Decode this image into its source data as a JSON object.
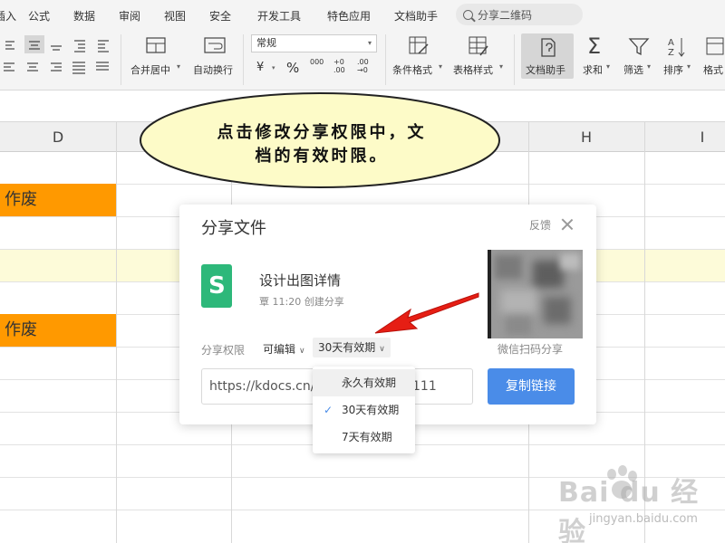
{
  "menu": {
    "items": [
      "插入",
      "公式",
      "数据",
      "审阅",
      "视图",
      "安全",
      "开发工具",
      "特色应用",
      "文档助手"
    ],
    "search_label": "分享二维码"
  },
  "ribbon": {
    "number_format": "常规",
    "merge_center": "合并居中",
    "wrap_text": "自动换行",
    "currency_symbol": "¥",
    "percent_symbol": "%",
    "thousands": "000",
    "inc_decimal": "+0 .00",
    "dec_decimal": ".00 →0",
    "conditional_format": "条件格式",
    "table_style": "表格样式",
    "doc_helper": "文档助手",
    "sum": "求和",
    "filter": "筛选",
    "sort": "排序",
    "format": "格式",
    "sum_glyph": "Σ"
  },
  "sheet": {
    "columns": [
      {
        "label": "D"
      },
      {
        "label": "H"
      },
      {
        "label": "I"
      }
    ],
    "cells": {
      "row2_d": "作废",
      "row6_d": "作废"
    }
  },
  "callout": {
    "line1": "点击修改分享权限中，文",
    "line2": "档的有效时限。"
  },
  "dialog": {
    "title": "分享文件",
    "feedback": "反馈",
    "file_icon_letter": "S",
    "file_name": "设计出图详情",
    "file_meta": "覃 11:20 创建分享",
    "qr_label": "微信扫码分享",
    "perm_label": "分享权限",
    "perm_edit": "可编辑",
    "perm_expiry": "30天有效期",
    "link_prefix": "https://kdocs.cn/",
    "link_suffix": "111",
    "copy_button": "复制链接"
  },
  "dropdown": {
    "items": [
      {
        "label": "永久有效期",
        "checked": false
      },
      {
        "label": "30天有效期",
        "checked": true
      },
      {
        "label": "7天有效期",
        "checked": false
      }
    ]
  },
  "watermark": {
    "brand": "Bai du 经验",
    "url": "jingyan.baidu.com"
  },
  "colors": {
    "accent_blue": "#4a8ce8",
    "wps_green": "#2db87a",
    "cell_orange": "#ff9900",
    "arrow_red": "#e61e14",
    "bubble_fill": "#fdfbc8"
  }
}
